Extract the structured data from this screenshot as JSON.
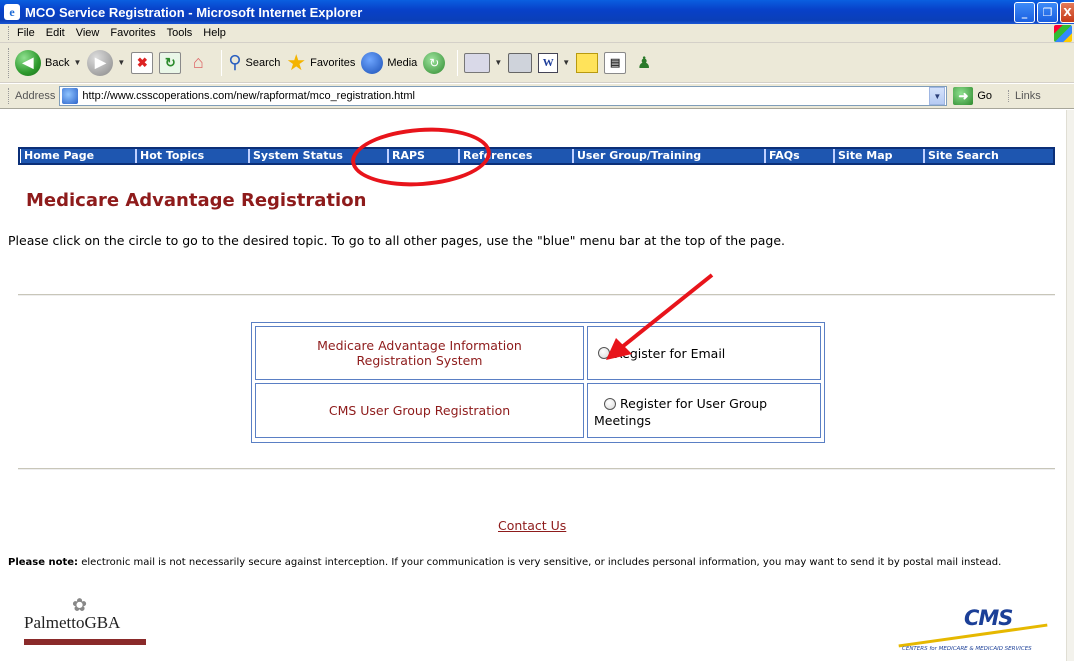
{
  "window": {
    "title": "MCO Service Registration - Microsoft Internet Explorer",
    "minimize": "_",
    "restore": "❐",
    "close": "X"
  },
  "menu": [
    "File",
    "Edit",
    "View",
    "Favorites",
    "Tools",
    "Help"
  ],
  "toolbar": {
    "back_label": "Back",
    "search_label": "Search",
    "favorites_label": "Favorites",
    "media_label": "Media"
  },
  "address": {
    "label": "Address",
    "url": "http://www.csscoperations.com/new/rapformat/mco_registration.html",
    "go_label": "Go",
    "links_label": "Links"
  },
  "nav": [
    {
      "label": "Home Page"
    },
    {
      "label": "Hot Topics"
    },
    {
      "label": "System Status"
    },
    {
      "label": "RAPS"
    },
    {
      "label": "References"
    },
    {
      "label": "User Group/Training"
    },
    {
      "label": "FAQs"
    },
    {
      "label": "Site Map"
    },
    {
      "label": "Site Search"
    }
  ],
  "page": {
    "heading": "Medicare Advantage Registration",
    "intro": "Please click on the circle to go to the desired topic. To go to all other pages, use the \"blue\" menu bar at the top of the page.",
    "rows": [
      {
        "topic": "Medicare Advantage Information Registration System",
        "option": "Register for Email"
      },
      {
        "topic": "CMS User Group Registration",
        "option": "Register for User Group Meetings"
      }
    ],
    "contact": "Contact Us",
    "note_bold": "Please note:",
    "note_text": " electronic mail is not necessarily secure against interception. If your communication is very sensitive, or includes personal information, you may want to send it by postal mail instead."
  },
  "logos": {
    "palmetto": "PalmettoGBA",
    "cms": "CMS",
    "cms_sub": "CENTERS for MEDICARE & MEDICAID SERVICES"
  },
  "colors": {
    "nav_bg": "#1e56b0",
    "heading": "#8e1b1b",
    "annotation": "#e8141b"
  }
}
